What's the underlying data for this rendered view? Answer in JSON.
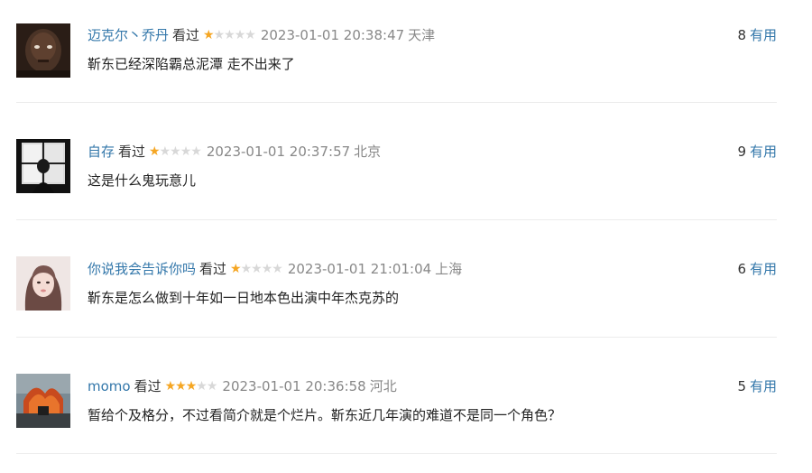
{
  "comments": [
    {
      "user": "迈克尔丶乔丹",
      "status": "看过",
      "rating": 1,
      "time": "2023-01-01 20:38:47",
      "location": "天津",
      "useful_count": "8",
      "useful_label": "有用",
      "content": "靳东已经深陷霸总泥潭 走不出来了"
    },
    {
      "user": "自存",
      "status": "看过",
      "rating": 1,
      "time": "2023-01-01 20:37:57",
      "location": "北京",
      "useful_count": "9",
      "useful_label": "有用",
      "content": "这是什么鬼玩意儿"
    },
    {
      "user": "你说我会告诉你吗",
      "status": "看过",
      "rating": 1,
      "time": "2023-01-01 21:01:04",
      "location": "上海",
      "useful_count": "6",
      "useful_label": "有用",
      "content": "靳东是怎么做到十年如一日地本色出演中年杰克苏的"
    },
    {
      "user": "momo",
      "status": "看过",
      "rating": 3,
      "time": "2023-01-01 20:36:58",
      "location": "河北",
      "useful_count": "5",
      "useful_label": "有用",
      "content": "暂给个及格分，不过看简介就是个烂片。靳东近几年演的难道不是同一个角色？"
    }
  ],
  "colors": {
    "link": "#3377aa",
    "star_on": "#f5a623",
    "star_off": "#d8d8d8",
    "meta": "#888888"
  }
}
